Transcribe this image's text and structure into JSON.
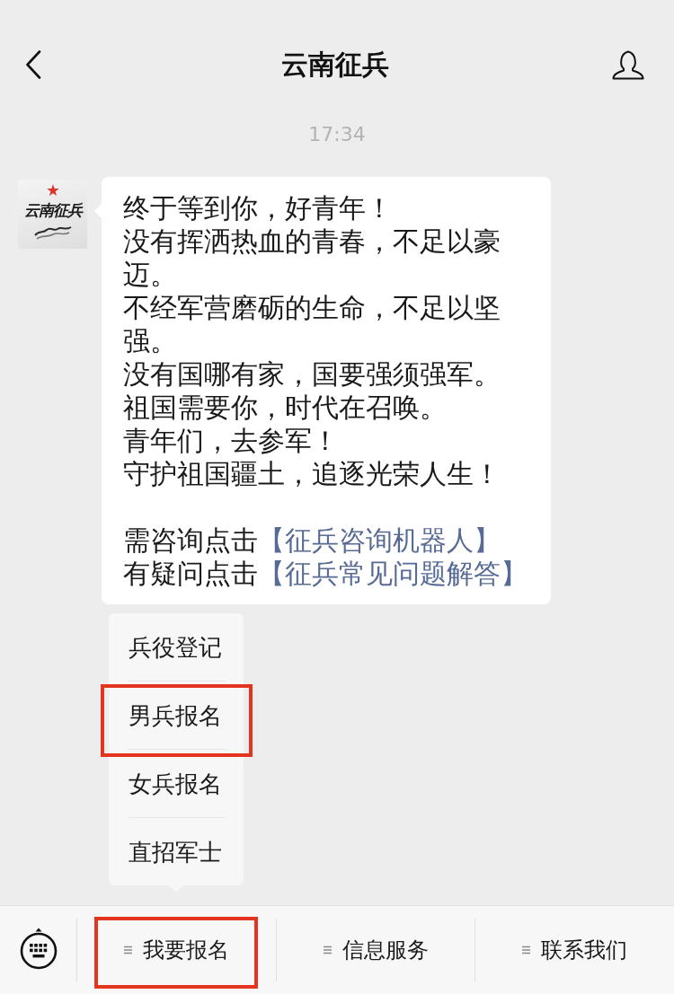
{
  "header": {
    "title": "云南征兵"
  },
  "timestamp": "17:34",
  "message": {
    "avatar": {
      "logo_text": "云南征兵"
    },
    "lines": [
      "终于等到你，好青年！",
      "没有挥洒热血的青春，不足以豪迈。",
      "不经军营磨砺的生命，不足以坚强。",
      "没有国哪有家，国要强须强军。",
      "祖国需要你，时代在召唤。",
      "青年们，去参军！",
      "守护祖国疆土，追逐光荣人生！"
    ],
    "link_lines": [
      {
        "prefix": "需咨询点击",
        "link": "【征兵咨询机器人】"
      },
      {
        "prefix": "有疑问点击",
        "link": "【征兵常见问题解答】"
      }
    ]
  },
  "bottom_bar": {
    "tabs": [
      {
        "label": "我要报名",
        "highlighted": true,
        "expanded": true,
        "submenu": [
          {
            "label": "兵役登记",
            "highlighted": false
          },
          {
            "label": "男兵报名",
            "highlighted": true
          },
          {
            "label": "女兵报名",
            "highlighted": false
          },
          {
            "label": "直招军士",
            "highlighted": false
          }
        ]
      },
      {
        "label": "信息服务",
        "highlighted": false,
        "expanded": false
      },
      {
        "label": "联系我们",
        "highlighted": false,
        "expanded": false
      }
    ]
  }
}
